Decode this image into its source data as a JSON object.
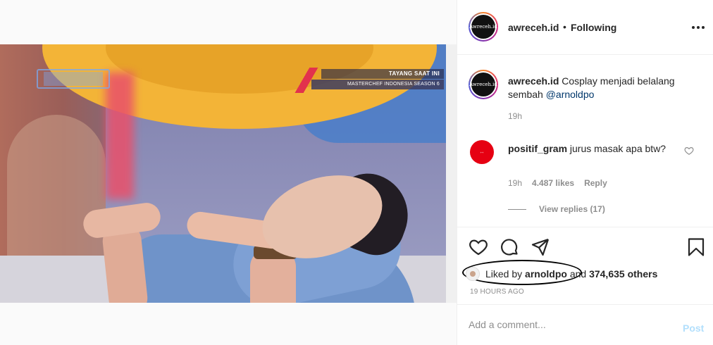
{
  "post": {
    "username": "awreceh.id",
    "separator": "•",
    "follow_status": "Following",
    "avatar_text": "Awreceh.id"
  },
  "photo": {
    "banner_top": "TAYANG SAAT INI",
    "banner_bottom": "MASTERCHEF INDONESIA SEASON 6"
  },
  "caption": {
    "username": "awreceh.id",
    "text": " Cosplay menjadi belalang sembah ",
    "mention": "@arnoldpo",
    "time": "19h"
  },
  "comment": {
    "username": "positif_gram",
    "text": " jurus masak apa btw?",
    "time": "19h",
    "likes": "4.487 likes",
    "reply": "Reply",
    "view_replies": "View replies (17)",
    "avatar_text": "++"
  },
  "likes": {
    "prefix": "Liked by ",
    "user": "arnoldpo",
    "middle": " and ",
    "count": "374,635 others",
    "timestamp": "19 HOURS AGO"
  },
  "add_comment": {
    "placeholder": "Add a comment...",
    "post_label": "Post"
  },
  "colors": {
    "link": "#00376b",
    "post_disabled": "#b2dffc",
    "secondary_text": "#8e8e8e"
  },
  "icons": [
    "more-icon",
    "heart-icon",
    "comment-icon",
    "share-icon",
    "bookmark-icon",
    "like-comment-heart-icon"
  ]
}
